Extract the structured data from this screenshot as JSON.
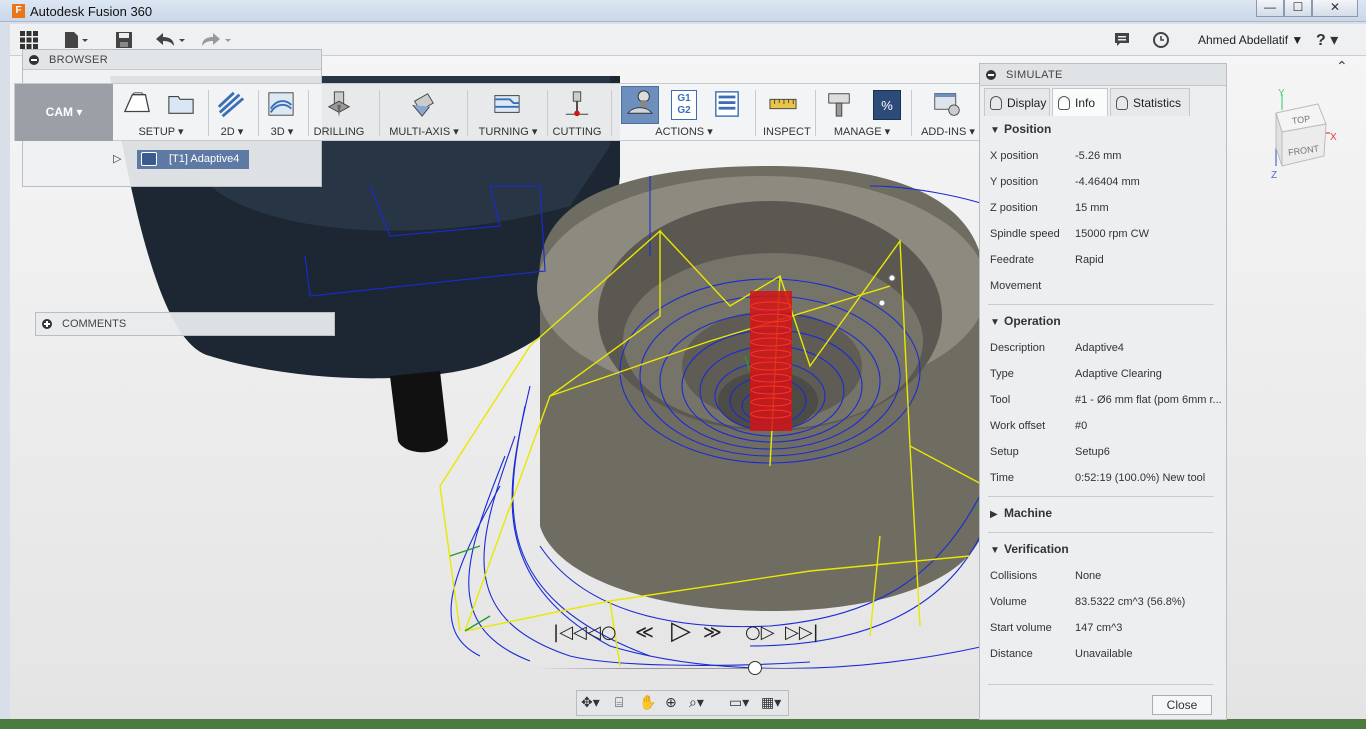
{
  "window": {
    "title": "Autodesk Fusion 360",
    "logo_letter": "F",
    "min": "—",
    "max": "☐",
    "close": "✕"
  },
  "appbar": {
    "user": "Ahmed Abdellatif ▼",
    "help": "? ▾"
  },
  "browser": {
    "title": "BROWSER",
    "node_label": "[T1] Adaptive4"
  },
  "comments": {
    "title": "COMMENTS"
  },
  "toolbar": {
    "workspace": "CAM ▾",
    "groups": [
      {
        "label": "SETUP ▾"
      },
      {
        "label": "2D ▾"
      },
      {
        "label": "3D ▾"
      },
      {
        "label": "DRILLING"
      },
      {
        "label": "MULTI-AXIS ▾"
      },
      {
        "label": "TURNING ▾"
      },
      {
        "label": "CUTTING"
      },
      {
        "label": "ACTIONS ▾"
      },
      {
        "label": "INSPECT"
      },
      {
        "label": "MANAGE ▾"
      },
      {
        "label": "ADD-INS ▾"
      }
    ],
    "g1g2": "G1 G2",
    "percent": "%"
  },
  "simulate": {
    "title": "SIMULATE",
    "tabs": [
      "Display",
      "Info",
      "Statistics"
    ],
    "position": {
      "heading": "Position",
      "rows": [
        {
          "k": "X position",
          "v": "-5.26 mm"
        },
        {
          "k": "Y position",
          "v": "-4.46404 mm"
        },
        {
          "k": "Z position",
          "v": "15 mm"
        },
        {
          "k": "Spindle speed",
          "v": "15000 rpm CW"
        },
        {
          "k": "Feedrate",
          "v": "Rapid"
        },
        {
          "k": "Movement",
          "v": ""
        }
      ]
    },
    "operation": {
      "heading": "Operation",
      "rows": [
        {
          "k": "Description",
          "v": "Adaptive4"
        },
        {
          "k": "Type",
          "v": "Adaptive Clearing"
        },
        {
          "k": "Tool",
          "v": "#1 - Ø6 mm flat (pom 6mm r..."
        },
        {
          "k": "Work offset",
          "v": "#0"
        },
        {
          "k": "Setup",
          "v": "Setup6"
        },
        {
          "k": "Time",
          "v": "0:52:19 (100.0%) New tool"
        }
      ]
    },
    "machine": {
      "heading": "Machine"
    },
    "verification": {
      "heading": "Verification",
      "rows": [
        {
          "k": "Collisions",
          "v": "None"
        },
        {
          "k": "Volume",
          "v": "83.5322 cm^3 (56.8%)"
        },
        {
          "k": "Start volume",
          "v": "147 cm^3"
        },
        {
          "k": "Distance",
          "v": "Unavailable"
        }
      ]
    },
    "close_label": "Close"
  },
  "viewcube": {
    "top": "TOP",
    "front": "FRONT",
    "x": "X",
    "y": "Y",
    "z": "Z"
  },
  "playback": {
    "to_start": "|◁◁",
    "prev_op": "◁○",
    "step_back": "≪",
    "play": "▷",
    "step_fwd": "≫",
    "next_op": "○▷",
    "to_end": "▷▷|"
  },
  "colors": {
    "toolpath_blue": "#1a2bd6",
    "toolpath_yellow": "#e8e800",
    "stock_gray": "#6f6c62",
    "tool_red": "#d41414",
    "cam_gray": "#9aa0a6",
    "selection_blue": "#5e7aa4"
  }
}
